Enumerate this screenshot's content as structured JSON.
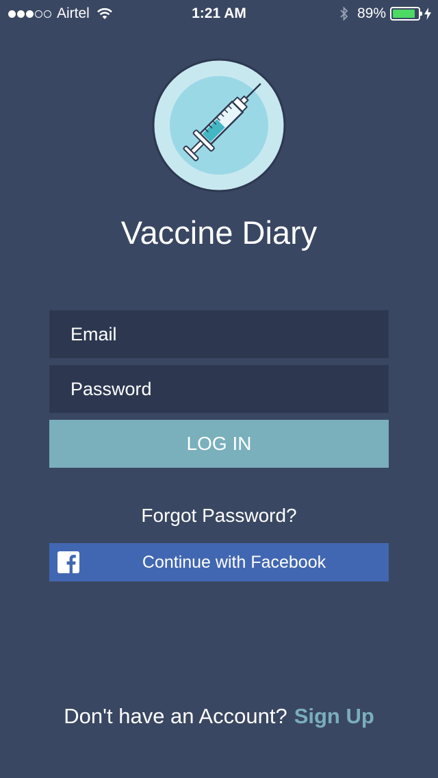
{
  "status_bar": {
    "carrier": "Airtel",
    "time": "1:21 AM",
    "battery_percent": "89%",
    "battery_level": 0.89,
    "signal_bars_filled": 3,
    "signal_bars_total": 5,
    "icons": [
      "wifi-icon",
      "bluetooth-icon",
      "battery-icon",
      "charging-bolt-icon"
    ]
  },
  "app": {
    "title": "Vaccine Diary",
    "logo": "syringe-icon"
  },
  "form": {
    "email_placeholder": "Email",
    "password_placeholder": "Password",
    "login_label": "LOG IN",
    "forgot_label": "Forgot Password?"
  },
  "facebook": {
    "label": "Continue with Facebook",
    "icon": "facebook-icon"
  },
  "signup": {
    "prompt": "Don't have an Account?",
    "link": "Sign Up"
  },
  "colors": {
    "background": "#3a4762",
    "input_background": "#2d3850",
    "accent": "#7aafbc",
    "facebook": "#4267b2",
    "battery": "#4cd964"
  }
}
